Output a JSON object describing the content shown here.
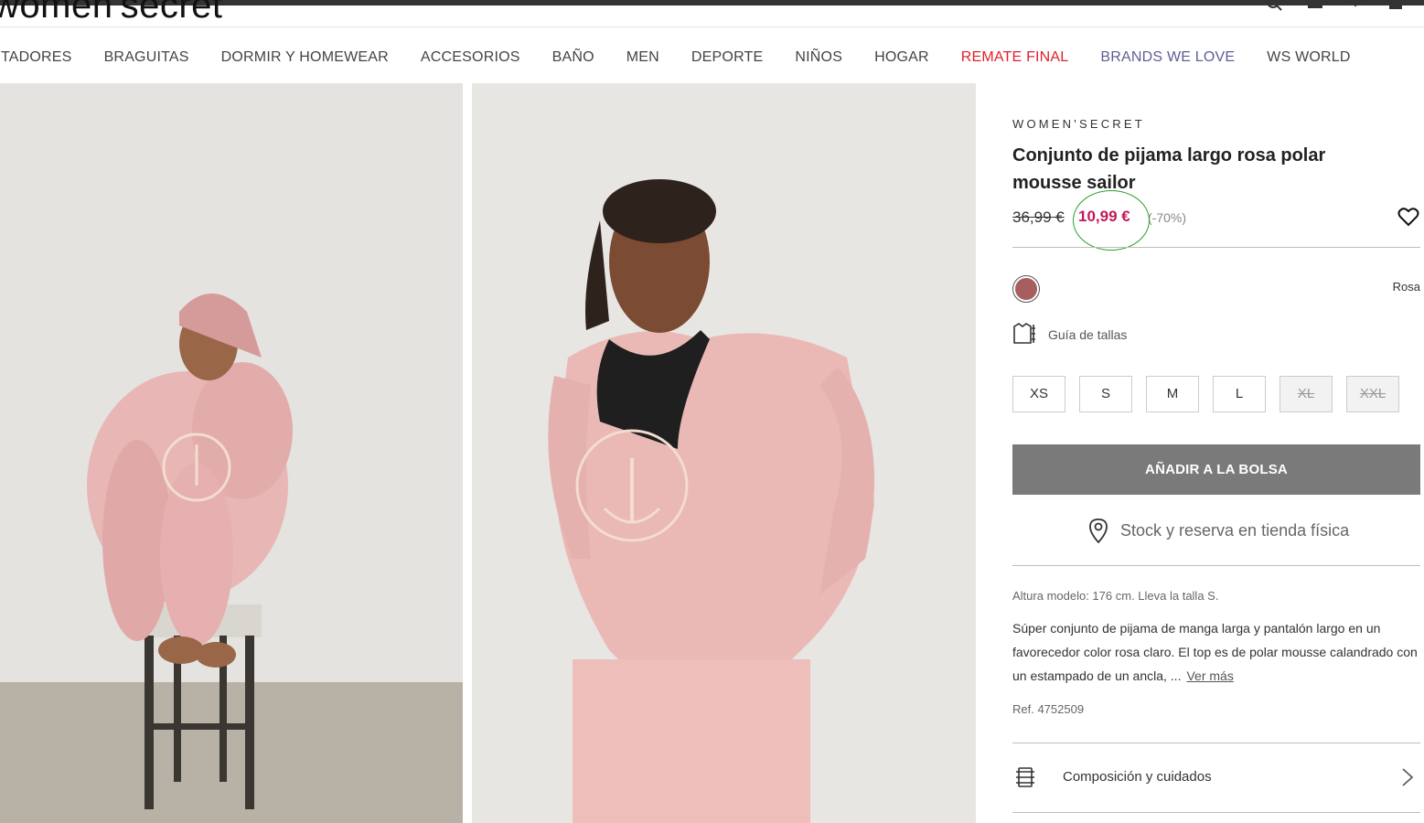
{
  "header": {
    "logo": "women'secret"
  },
  "nav": {
    "items": [
      {
        "label": "TADORES"
      },
      {
        "label": "BRAGUITAS"
      },
      {
        "label": "DORMIR Y HOMEWEAR"
      },
      {
        "label": "ACCESORIOS"
      },
      {
        "label": "BAÑO"
      },
      {
        "label": "MEN"
      },
      {
        "label": "DEPORTE"
      },
      {
        "label": "NIÑOS"
      },
      {
        "label": "HOGAR"
      },
      {
        "label": "REMATE FINAL"
      },
      {
        "label": "BRANDS WE LOVE"
      },
      {
        "label": "WS WORLD"
      }
    ]
  },
  "product": {
    "brand": "WOMEN'SECRET",
    "title": "Conjunto de pijama largo rosa polar mousse sailor",
    "old_price": "36,99 €",
    "price": "10,99 €",
    "discount": "(-70%)",
    "color_name": "Rosa",
    "swatch_color": "#a65e5e",
    "size_guide": "Guía de tallas",
    "sizes": [
      {
        "label": "XS",
        "available": true
      },
      {
        "label": "S",
        "available": true
      },
      {
        "label": "M",
        "available": true
      },
      {
        "label": "L",
        "available": true
      },
      {
        "label": "XL",
        "available": false
      },
      {
        "label": "XXL",
        "available": false
      }
    ],
    "add_to_bag": "AÑADIR A LA BOLSA",
    "stock": "Stock y reserva en tienda física",
    "model_info": "Altura modelo: 176 cm.  Lleva la talla S.",
    "description": "Súper conjunto de pijama de manga larga y pantalón largo en un favorecedor color rosa claro. El top es de polar mousse calandrado con un estampado de un ancla, ...",
    "see_more": "Ver más",
    "ref": "Ref. 4752509",
    "composition": "Composición y cuidados"
  },
  "colors": {
    "price_accent": "#c2185b",
    "remate": "#e0202b",
    "brands": "#5e5e96",
    "button": "#7a7a7a"
  }
}
